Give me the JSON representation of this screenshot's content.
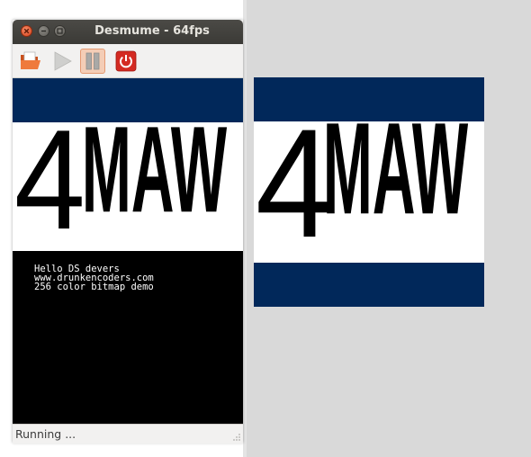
{
  "window": {
    "title": "Desmume - 64fps",
    "buttons": [
      "close",
      "minimize",
      "maximize"
    ]
  },
  "toolbar": {
    "items": [
      {
        "name": "open-rom",
        "icon": "folder-open-icon",
        "enabled": true
      },
      {
        "name": "run",
        "icon": "play-icon",
        "enabled": false
      },
      {
        "name": "pause",
        "icon": "pause-icon",
        "enabled": true,
        "active": true
      },
      {
        "name": "quit",
        "icon": "power-icon",
        "enabled": true
      }
    ]
  },
  "screen": {
    "logo_number": "4",
    "logo_letters": "MAW",
    "console_lines": [
      "Hello DS devers",
      "www.drunkencoders.com",
      "256 color bitmap demo"
    ]
  },
  "status": {
    "text": "Running ..."
  },
  "colors": {
    "band": "#01285a",
    "title_bar": "#3f3e3a",
    "logo": "#000000"
  }
}
